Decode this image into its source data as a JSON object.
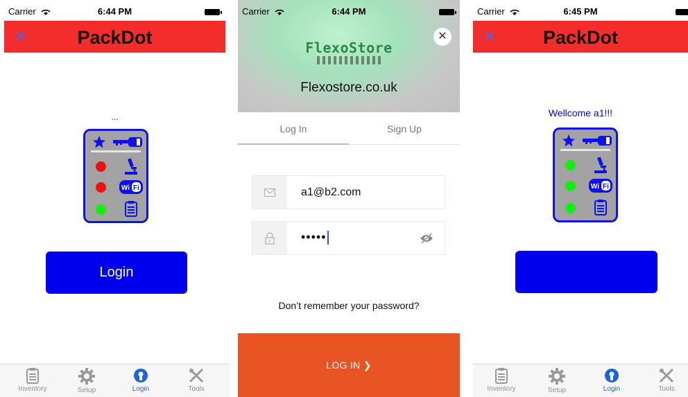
{
  "screen1": {
    "status": {
      "carrier": "Carrier",
      "time": "6:44 PM"
    },
    "header": {
      "title": "PackDot",
      "close_icon": "close-icon"
    },
    "status_dots": "...",
    "device": {
      "leds": [
        "#ee1111",
        "#ee1111",
        "#11ee11"
      ]
    },
    "login_label": "Login"
  },
  "screen2": {
    "status": {
      "carrier": "Carrier",
      "time": "6:44 PM"
    },
    "logo": "FlexoStore",
    "site": "Flexostore.co.uk",
    "tabs": [
      "Log In",
      "Sign Up"
    ],
    "email_value": "a1@b2.com",
    "password_value": "•••••",
    "forgot": "Don’t remember your password?",
    "login_button": "LOG IN  ❯"
  },
  "screen3": {
    "status": {
      "carrier": "Carrier",
      "time": "6:45 PM"
    },
    "header": {
      "title": "PackDot"
    },
    "welcome": "Wellcome a1!!!",
    "device": {
      "leds": [
        "#11ee11",
        "#11ee11",
        "#11ee11"
      ]
    }
  },
  "tabbar": {
    "tabs": [
      {
        "label": "Inventory",
        "icon": "clipboard-icon"
      },
      {
        "label": "Setup",
        "icon": "gear-icon"
      },
      {
        "label": "Login",
        "icon": "login-icon",
        "active": true
      },
      {
        "label": "Tools",
        "icon": "tools-icon"
      }
    ]
  },
  "colors": {
    "header_red": "#f42c2c",
    "primary_blue": "#0000ee",
    "orange": "#e85424",
    "tab_active": "#1e63d9"
  }
}
